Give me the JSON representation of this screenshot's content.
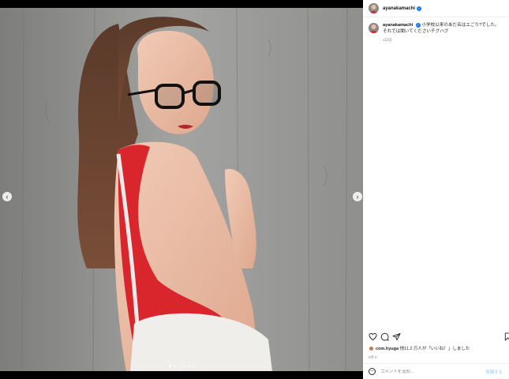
{
  "post": {
    "username": "ayanakamachi",
    "caption": "小学校以来のあだ名はエごり?でした。それでは聞いてくださいチグハグ",
    "time_ago": "1日前",
    "image_count": 6,
    "active_image": 0
  },
  "likes": {
    "liker": "com.hyuga",
    "text": "他11.2 万人が「いいね！」しました"
  },
  "date": "8月 6",
  "comment": {
    "placeholder": "コメントを追加...",
    "post_label": "投稿する"
  },
  "icons": {
    "like": "heart-icon",
    "comment": "comment-icon",
    "share": "share-icon",
    "save": "bookmark-icon",
    "emoji": "emoji-icon",
    "prev": "chevron-left-icon",
    "next": "chevron-right-icon"
  },
  "colors": {
    "verified": "#1877f2",
    "top": "#d8262c",
    "wall": "#9a9a98"
  }
}
